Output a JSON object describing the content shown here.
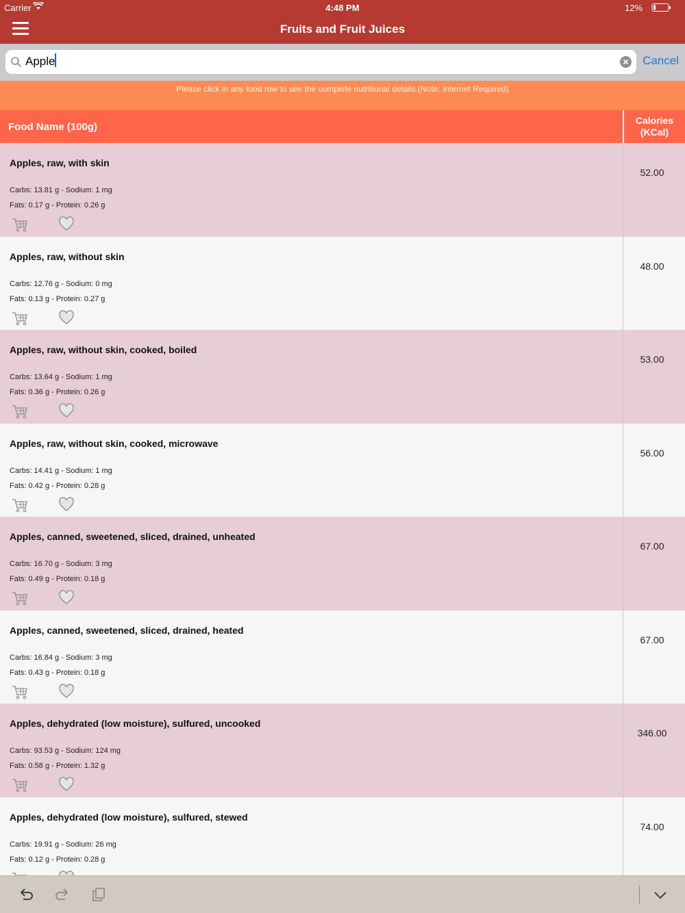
{
  "status_bar": {
    "carrier": "Carrier",
    "time": "4:48 PM",
    "battery": "12%"
  },
  "nav": {
    "title": "Fruits and Fruit Juices",
    "menu_icon": "hamburger-icon"
  },
  "search": {
    "value": "Apple",
    "cancel_label": "Cancel"
  },
  "banner": {
    "text": "Please click in any food row to see the complete nutritional details.(Note: Internet Required)"
  },
  "table": {
    "headers": {
      "name": "Food Name (100g)",
      "calories_line1": "Calories",
      "calories_line2": "(KCal)"
    },
    "rows": [
      {
        "name": "Apples, raw, with skin",
        "line1": "Carbs: 13.81 g - Sodium: 1 mg",
        "line2": "Fats: 0.17 g - Protein: 0.26 g",
        "calories": "52.00"
      },
      {
        "name": "Apples, raw, without skin",
        "line1": "Carbs: 12.76 g - Sodium: 0 mg",
        "line2": "Fats: 0.13 g - Protein: 0.27 g",
        "calories": "48.00"
      },
      {
        "name": "Apples, raw, without skin, cooked, boiled",
        "line1": "Carbs: 13.64 g - Sodium: 1 mg",
        "line2": "Fats: 0.36 g - Protein: 0.26 g",
        "calories": "53.00"
      },
      {
        "name": "Apples, raw, without skin, cooked, microwave",
        "line1": "Carbs: 14.41 g - Sodium: 1 mg",
        "line2": "Fats: 0.42 g - Protein: 0.28 g",
        "calories": "56.00"
      },
      {
        "name": "Apples, canned, sweetened, sliced, drained, unheated",
        "line1": "Carbs: 16.70 g - Sodium: 3 mg",
        "line2": "Fats: 0.49 g - Protein: 0.18 g",
        "calories": "67.00"
      },
      {
        "name": "Apples, canned, sweetened, sliced, drained, heated",
        "line1": "Carbs: 16.84 g - Sodium: 3 mg",
        "line2": "Fats: 0.43 g - Protein: 0.18 g",
        "calories": "67.00"
      },
      {
        "name": "Apples, dehydrated (low moisture), sulfured, uncooked",
        "line1": "Carbs: 93.53 g - Sodium: 124 mg",
        "line2": "Fats: 0.58 g - Protein: 1.32 g",
        "calories": "346.00"
      },
      {
        "name": "Apples, dehydrated (low moisture), sulfured, stewed",
        "line1": "Carbs: 19.91 g - Sodium: 26 mg",
        "line2": "Fats: 0.12 g - Protein: 0.28 g",
        "calories": "74.00"
      }
    ]
  },
  "toolbar": {
    "icons": [
      "undo-icon",
      "redo-icon",
      "paste-icon",
      "chevron-down-icon"
    ]
  },
  "colors": {
    "nav": "#b53a31",
    "banner": "#ff8b52",
    "header": "#ff6549",
    "row_alt": "#e6cdd8"
  }
}
